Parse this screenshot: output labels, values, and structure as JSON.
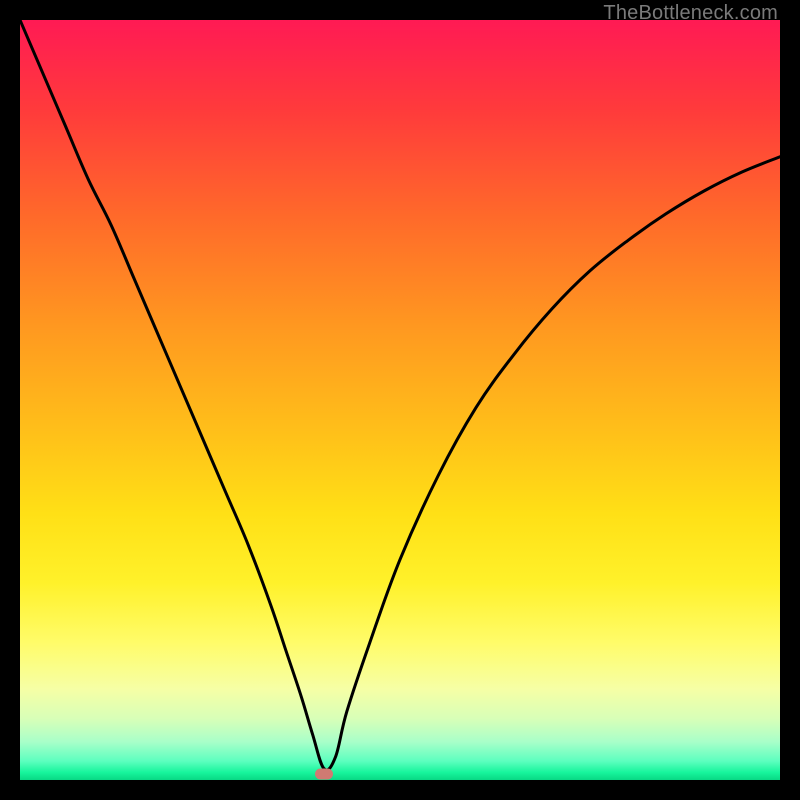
{
  "watermark": "TheBottleneck.com",
  "chart_data": {
    "type": "line",
    "title": "",
    "xlabel": "",
    "ylabel": "",
    "xlim": [
      0,
      100
    ],
    "ylim": [
      0,
      100
    ],
    "series": [
      {
        "name": "bottleneck-curve",
        "x": [
          0,
          3,
          6,
          9,
          12,
          15,
          18,
          21,
          24,
          27,
          30,
          33,
          35,
          37,
          38.5,
          40,
          41.5,
          43,
          46,
          50,
          55,
          60,
          65,
          70,
          75,
          80,
          85,
          90,
          95,
          100
        ],
        "y": [
          100,
          93,
          86,
          79,
          73,
          66,
          59,
          52,
          45,
          38,
          31,
          23,
          17,
          11,
          6,
          1.5,
          3,
          9,
          18,
          29,
          40,
          49,
          56,
          62,
          67,
          71,
          74.5,
          77.5,
          80,
          82
        ]
      }
    ],
    "marker": {
      "x": 40,
      "y": 0.8
    },
    "gradient_stops": [
      {
        "pct": 0,
        "color": "#ff1a54"
      },
      {
        "pct": 12,
        "color": "#ff3b3b"
      },
      {
        "pct": 26,
        "color": "#ff6a2a"
      },
      {
        "pct": 40,
        "color": "#ff9720"
      },
      {
        "pct": 55,
        "color": "#ffc219"
      },
      {
        "pct": 65,
        "color": "#ffe016"
      },
      {
        "pct": 74,
        "color": "#fff12a"
      },
      {
        "pct": 82,
        "color": "#fffc6a"
      },
      {
        "pct": 88,
        "color": "#f6ffa5"
      },
      {
        "pct": 92,
        "color": "#d7ffb8"
      },
      {
        "pct": 95,
        "color": "#a8ffc9"
      },
      {
        "pct": 97.5,
        "color": "#5dffbf"
      },
      {
        "pct": 99,
        "color": "#17f59c"
      },
      {
        "pct": 100,
        "color": "#08d884"
      }
    ]
  }
}
